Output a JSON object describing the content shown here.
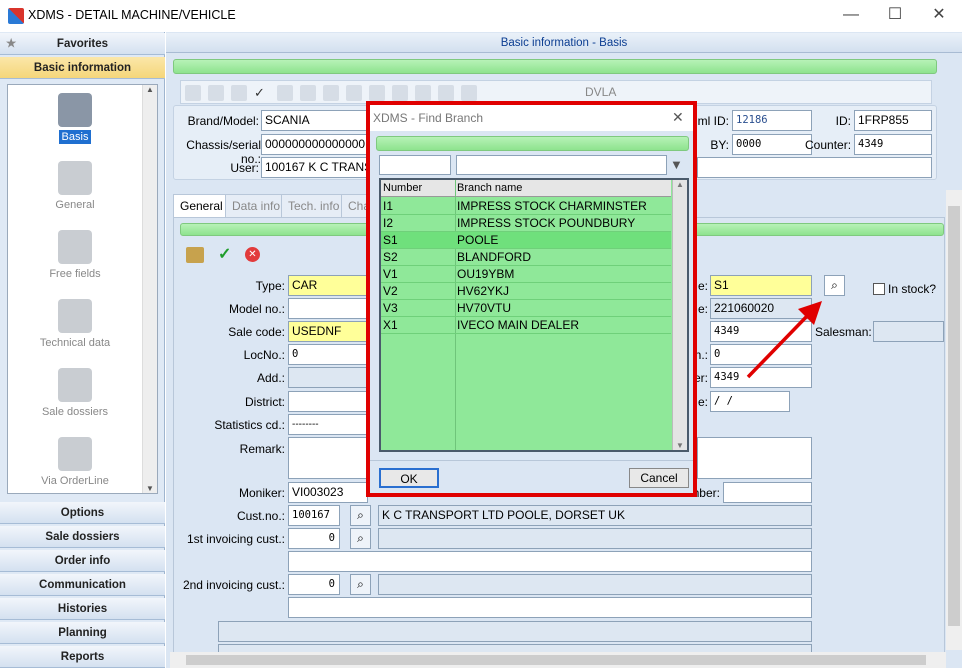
{
  "window": {
    "title": "XDMS - DETAIL MACHINE/VEHICLE",
    "min": "—",
    "max": "☐",
    "close": "✕"
  },
  "sidebar": {
    "favorites": "Favorites",
    "basic": "Basic information",
    "nav": [
      {
        "label": "Basis"
      },
      {
        "label": "General"
      },
      {
        "label": "Free fields"
      },
      {
        "label": "Technical data"
      },
      {
        "label": "Sale dossiers"
      },
      {
        "label": "Via OrderLine"
      }
    ],
    "bottom": [
      "Options",
      "Sale dossiers",
      "Order info",
      "Communication",
      "Histories",
      "Planning",
      "Reports"
    ]
  },
  "main": {
    "header": "Basic information - Basis",
    "toolbar_text": "DVLA",
    "brand_model": {
      "label": "Brand/Model:",
      "value": "SCANIA"
    },
    "chassis": {
      "label": "Chassis/serial no.:",
      "value": "0000000000000001"
    },
    "user": {
      "label": "User:",
      "value": "100167  K C TRANS"
    },
    "id1": {
      "label": "ml ID:",
      "value": "12186"
    },
    "id2": {
      "label": "ID:",
      "value": "1FRP855"
    },
    "by": {
      "label": "BY:",
      "value": "0000"
    },
    "counter": {
      "label": "Counter:",
      "value": "4349"
    },
    "tabs": [
      "General",
      "Data info",
      "Tech. info",
      "Cha"
    ],
    "type": {
      "label": "Type:",
      "value": "CAR"
    },
    "model_no": {
      "label": "Model no.:"
    },
    "sale_code": {
      "label": "Sale code:",
      "value": "USEDNF"
    },
    "locno": {
      "label": "LocNo.:",
      "value": "0"
    },
    "add": {
      "label": "Add.:"
    },
    "district": {
      "label": "District:"
    },
    "stat": {
      "label": "Statistics cd.:",
      "value": "--------"
    },
    "remark": {
      "label": "Remark:"
    },
    "moniker": {
      "label": "Moniker:",
      "value": "VI003023"
    },
    "cust": {
      "label": "Cust.no.:",
      "value": "100167",
      "name": "K C TRANSPORT LTD POOLE,  DORSET UK"
    },
    "inv1": {
      "label": "1st invoicing cust.:",
      "value": "0"
    },
    "inv2": {
      "label": "2nd invoicing cust.:",
      "value": "0"
    },
    "right": {
      "branch_lbl": "e:",
      "branch": "S1",
      "date_lbl": "e:",
      "date": "221060020",
      "v1": "4349",
      "n_lbl": "n.:",
      "n": "0",
      "er_lbl": "er:",
      "er": "4349",
      "e2_lbl": "e:",
      "e2": "  /   /",
      "umber": "umber:"
    },
    "instock": "In stock?",
    "salesman": "Salesman:"
  },
  "dialog": {
    "title": "XDMS  -  Find Branch",
    "close": "✕",
    "col_number": "Number",
    "col_name": "Branch name",
    "rows": [
      {
        "num": "I1",
        "name": "IMPRESS STOCK CHARMINSTER"
      },
      {
        "num": "I2",
        "name": "IMPRESS STOCK POUNDBURY"
      },
      {
        "num": "S1",
        "name": "POOLE"
      },
      {
        "num": "S2",
        "name": "BLANDFORD"
      },
      {
        "num": "V1",
        "name": "OU19YBM"
      },
      {
        "num": "V2",
        "name": "HV62YKJ"
      },
      {
        "num": "V3",
        "name": "HV70VTU"
      },
      {
        "num": "X1",
        "name": "IVECO MAIN DEALER"
      }
    ],
    "ok": "OK",
    "cancel": "Cancel"
  },
  "colors": {
    "highlight": "#e00000",
    "grid_green": "#8fe899"
  }
}
